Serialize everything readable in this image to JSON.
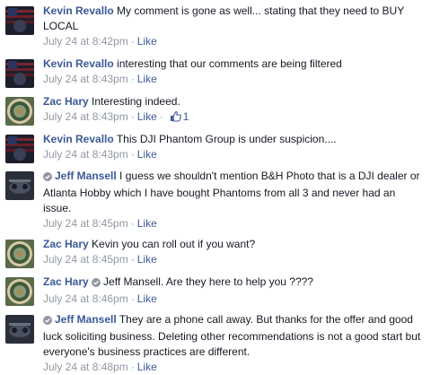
{
  "comments": [
    {
      "author": "Kevin Revallo",
      "text": "My comment is gone as well... stating that they need to BUY LOCAL",
      "time": "July 24 at 8:42pm",
      "like": "Like"
    },
    {
      "author": "Kevin Revallo",
      "text": "interesting that our comments are being filtered",
      "time": "July 24 at 8:43pm",
      "like": "Like"
    },
    {
      "author": "Zac Hary",
      "text": "Interesting indeed.",
      "time": "July 24 at 8:43pm",
      "like": "Like",
      "like_count": "1"
    },
    {
      "author": "Kevin Revallo",
      "text": "This DJI Phantom Group is under suspicion....",
      "time": "July 24 at 8:43pm",
      "like": "Like"
    },
    {
      "author": "Jeff Mansell",
      "text": "I guess we shouldn't mention B&H Photo that is a DJI dealer or Atlanta Hobby which I have bought Phantoms from all 3 and never had an issue.",
      "time": "July 24 at 8:45pm",
      "like": "Like"
    },
    {
      "author": "Zac Hary",
      "text": "Kevin you can roll out if you want?",
      "time": "July 24 at 8:45pm",
      "like": "Like"
    },
    {
      "author": "Zac Hary",
      "mention": "Jeff Mansell",
      "text": ". Are they here to help you ????",
      "time": "July 24 at 8:46pm",
      "like": "Like"
    },
    {
      "author": "Jeff Mansell",
      "text": "They are a phone call away. But thanks for the offer and good luck soliciting business. Deleting other recommendations is not a good start but everyone's business practices are different.",
      "time": "July 24 at 8:48pm",
      "like": "Like"
    }
  ]
}
